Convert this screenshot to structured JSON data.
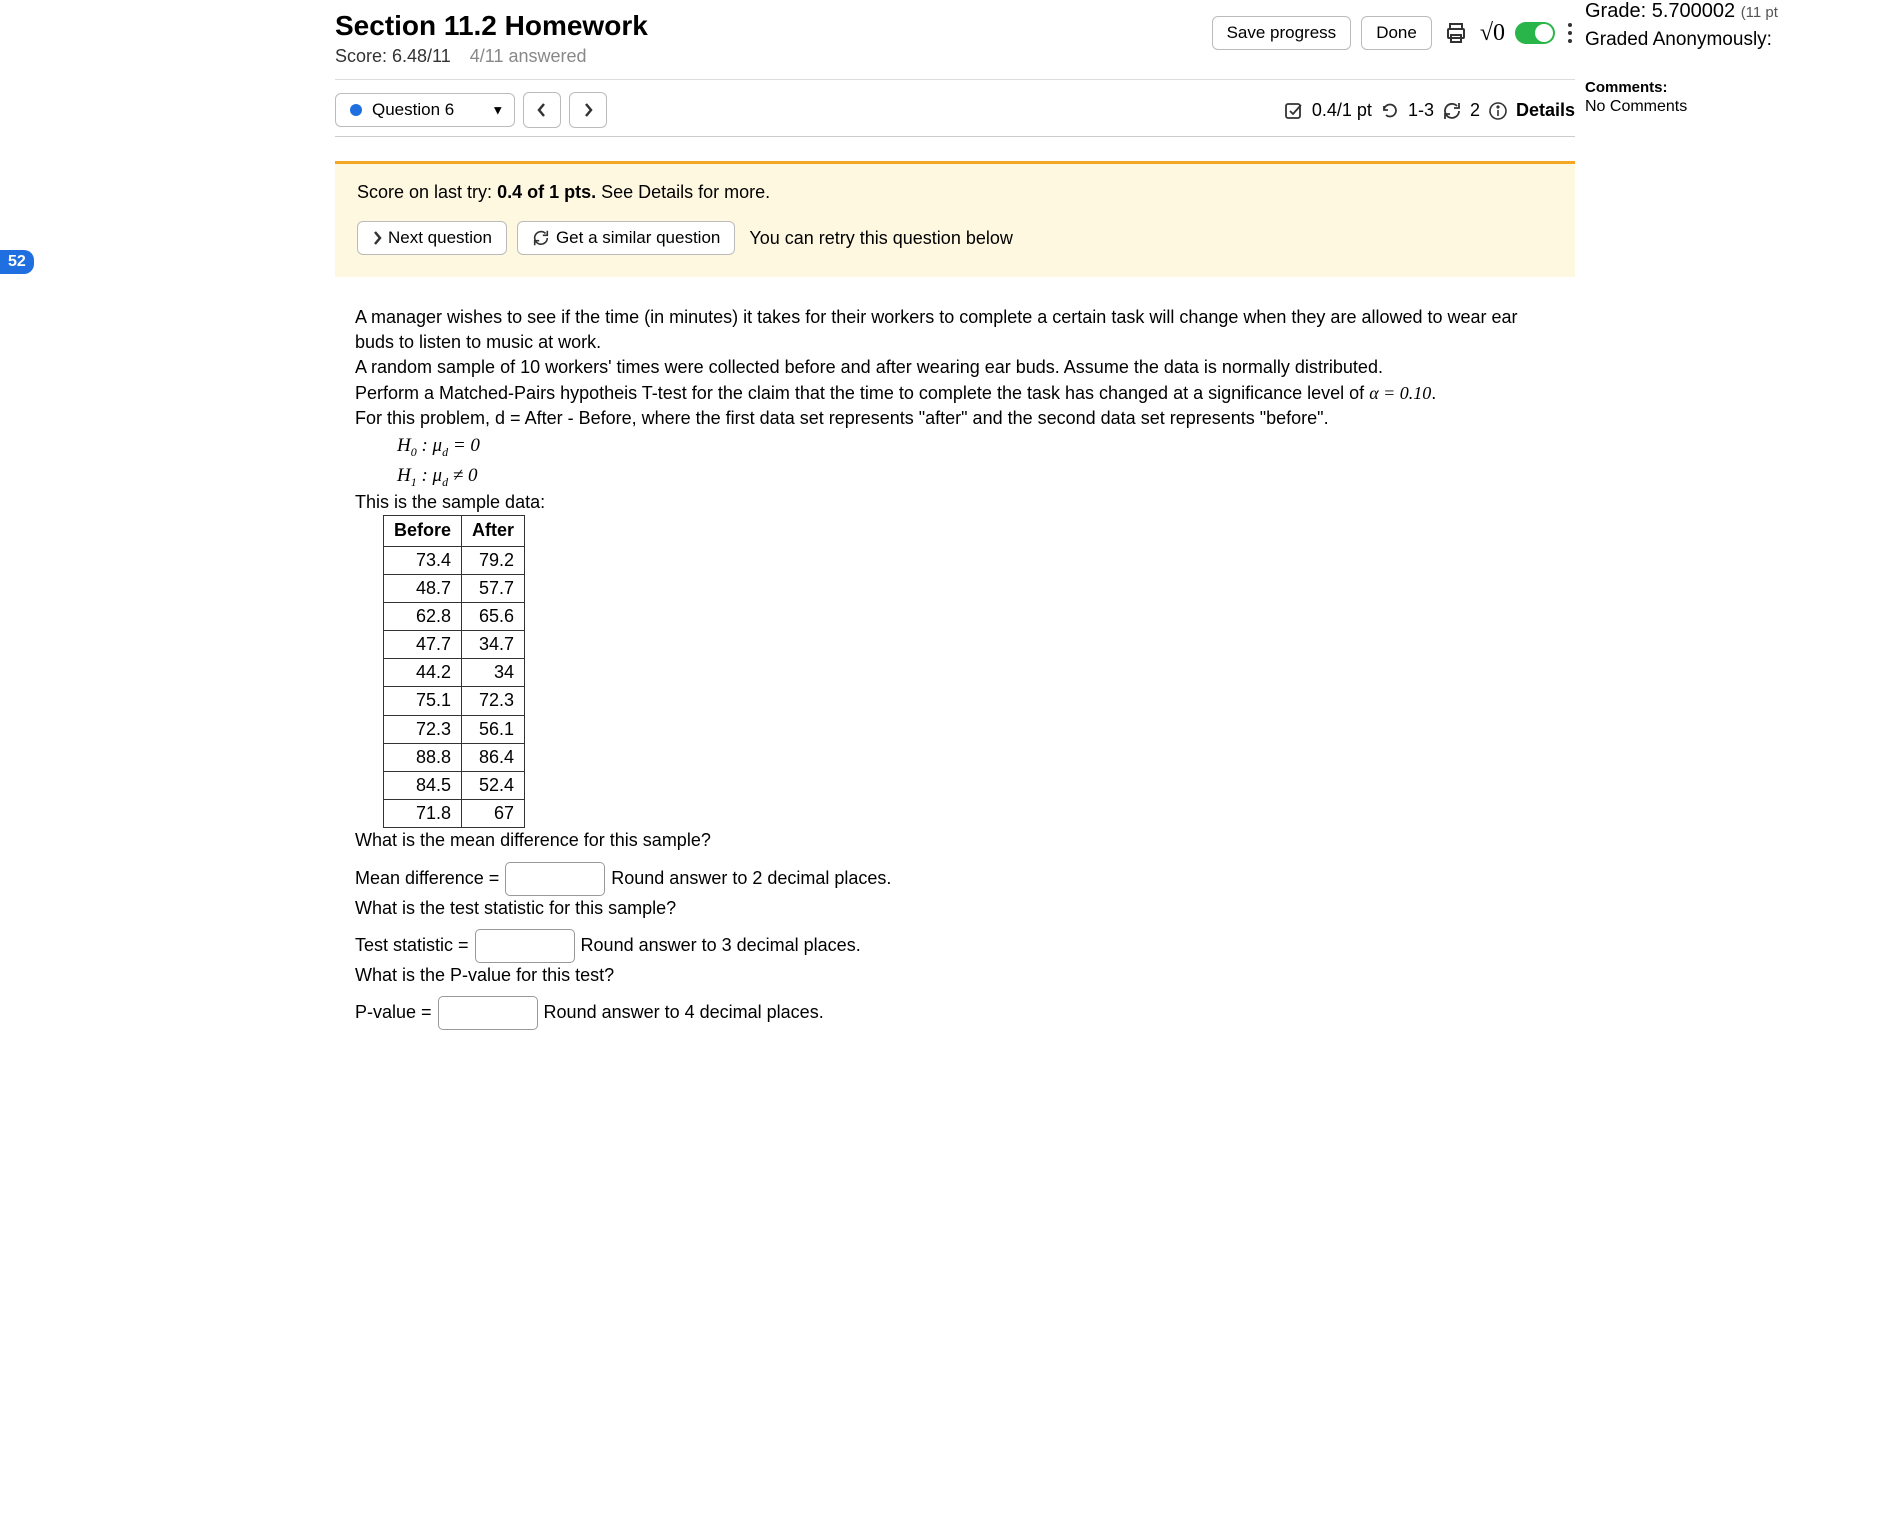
{
  "sideBadge": "52",
  "header": {
    "title": "Section 11.2 Homework",
    "score_label": "Score: 6.48/11",
    "answered": "4/11 answered",
    "save_btn": "Save progress",
    "done_btn": "Done",
    "sqrt_text": "√0"
  },
  "rightMeta": {
    "grade_label": "Grade: 5.700002",
    "grade_pts": "(11 pt",
    "graded_anon": "Graded Anonymously:",
    "comments_h": "Comments:",
    "no_comments": "No Comments"
  },
  "qbar": {
    "question_label": "Question 6",
    "pts": "0.4/1 pt",
    "tries": "1-3",
    "retries": "2",
    "details": "Details"
  },
  "tryBox": {
    "prefix": "Score on last try: ",
    "bold": "0.4 of 1 pts.",
    "suffix": " See Details for more.",
    "next_btn": "Next question",
    "similar_btn": "Get a similar question",
    "retry_text": "You can retry this question below"
  },
  "problem": {
    "p1": "A manager wishes to see if the time (in minutes) it takes for their workers to complete a certain task will change when they are allowed to wear ear buds to listen to music at work.",
    "p2": "A random sample of 10 workers' times were collected before and after wearing ear buds. Assume the data is normally distributed.",
    "p3_a": "Perform a Matched-Pairs hypotheis T-test for the claim that the time to complete the task has changed at a significance level of ",
    "p3_alpha": "α = 0.10",
    "p3_b": ".",
    "p4": "For this problem, d = After - Before, where the first data set represents \"after\" and the second data set represents \"before\".",
    "h0": "H₀ : μ_d = 0",
    "h1": "H₁ : μ_d ≠ 0",
    "sample_label": "This is the sample data:",
    "table": {
      "headers": [
        "Before",
        "After"
      ],
      "rows": [
        [
          "73.4",
          "79.2"
        ],
        [
          "48.7",
          "57.7"
        ],
        [
          "62.8",
          "65.6"
        ],
        [
          "47.7",
          "34.7"
        ],
        [
          "44.2",
          "34"
        ],
        [
          "75.1",
          "72.3"
        ],
        [
          "72.3",
          "56.1"
        ],
        [
          "88.8",
          "86.4"
        ],
        [
          "84.5",
          "52.4"
        ],
        [
          "71.8",
          "67"
        ]
      ]
    },
    "q_mean": "What is the mean difference for this sample?",
    "mean_label": "Mean difference =",
    "mean_round": "Round answer to 2 decimal places.",
    "q_tstat": "What is the test statistic for this sample?",
    "tstat_label": "Test statistic =",
    "tstat_round": "Round answer to 3 decimal places.",
    "q_pval": "What is the P-value for this test?",
    "pval_label": "P-value =",
    "pval_round": "Round answer to 4 decimal places."
  }
}
